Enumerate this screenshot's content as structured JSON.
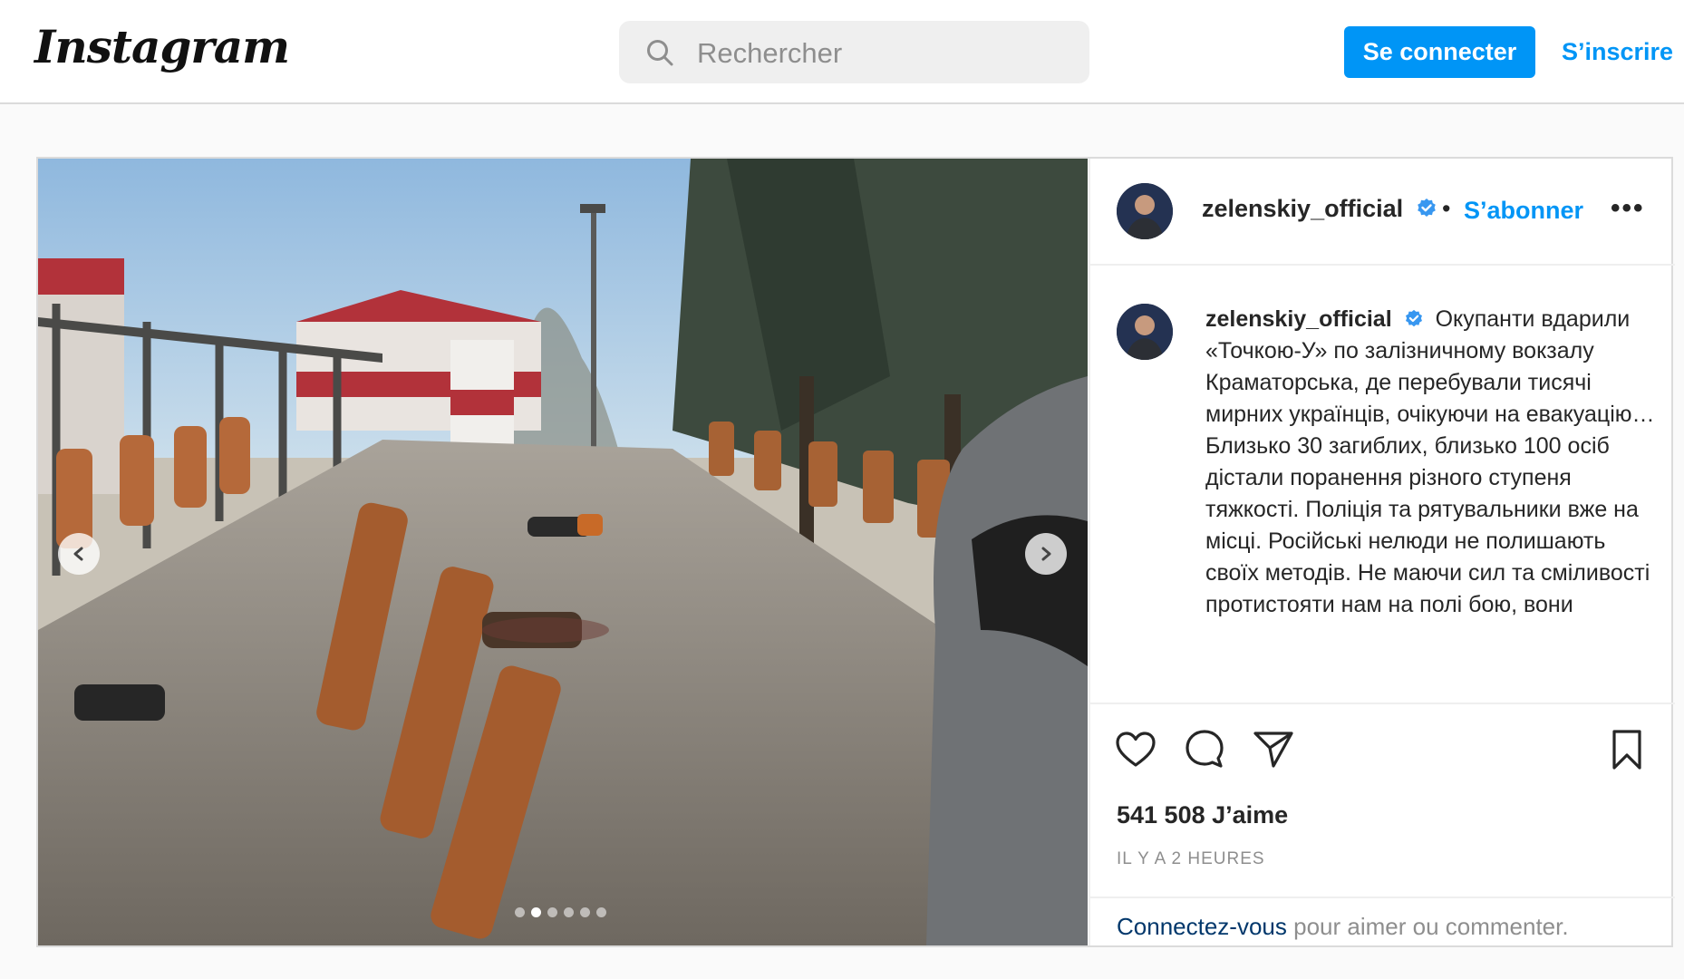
{
  "topbar": {
    "logo": "Instagram",
    "search_placeholder": "Rechercher",
    "login_button": "Se connecter",
    "signup_link": "S’inscrire"
  },
  "post": {
    "header": {
      "username": "zelenskiy_official",
      "separator": "•",
      "follow": "S’abonner",
      "more": "•••"
    },
    "caption": {
      "username": "zelenskiy_official",
      "text": "Окупанти вдарили «Точкою-У» по залізничному вокзалу Краматорська, де перебували тисячі мирних українців, очікуючи на евакуацію… Близько 30 загиблих, близько 100 осіб дістали поранення різного ступеня тяжкості. Поліція та рятувальники вже на місці. Російські нелюди не полишають своїх методів. Не маючи сил та сміливості протистояти нам на полі бою, вони"
    },
    "likes": "541 508 J’aime",
    "timestamp": "IL Y A 2 HEURES",
    "login_prompt": {
      "link": "Connectez-vous",
      "text": " pour aimer ou commenter."
    },
    "carousel": {
      "total": 6,
      "active_index": 1
    },
    "icons": {
      "like": "heart-icon",
      "comment": "comment-icon",
      "share": "paper-plane-icon",
      "save": "bookmark-icon"
    },
    "colors": {
      "accent": "#0095f6",
      "verified": "#3897f0",
      "link_dark": "#00376b"
    }
  }
}
